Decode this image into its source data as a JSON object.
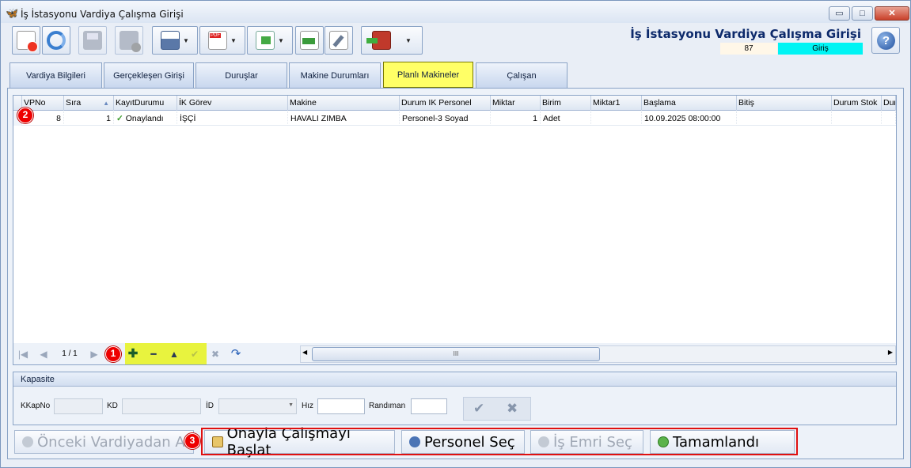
{
  "window": {
    "title": "İş İstasyonu Vardiya Çalışma Girişi",
    "controls": {
      "minimize": "▭",
      "maximize": "□",
      "close": "✕"
    }
  },
  "header": {
    "form_title": "İş İstasyonu Vardiya Çalışma Girişi",
    "record_number": "87",
    "mode": "Giriş",
    "mode_color": "#00f4f4"
  },
  "toolbar": {
    "buttons": [
      {
        "icon": "new-delete-icon"
      },
      {
        "icon": "refresh-icon"
      },
      {
        "icon": "save-icon"
      },
      {
        "icon": "save-cancel-icon"
      },
      {
        "icon": "print-icon"
      },
      {
        "icon": "pdf-export-icon"
      },
      {
        "icon": "copy-export-icon"
      },
      {
        "icon": "import-icon"
      },
      {
        "icon": "settings-wrench-icon"
      },
      {
        "icon": "exit-door-icon"
      }
    ]
  },
  "tabs": [
    {
      "label": "Vardiya Bilgileri"
    },
    {
      "label": "Gerçekleşen Girişi"
    },
    {
      "label": "Duruşlar"
    },
    {
      "label": "Makine Durumları"
    },
    {
      "label": "Planlı Makineler",
      "active": true
    },
    {
      "label": "Çalışan"
    }
  ],
  "grid": {
    "columns": [
      "VPNo",
      "Sıra",
      "KayıtDurumu",
      "İK Görev",
      "Makine",
      "Durum IK Personel",
      "Miktar",
      "Birim",
      "Miktar1",
      "Başlama",
      "Bitiş",
      "Durum Stok",
      "Dur"
    ],
    "rows": [
      {
        "VPNo": "8",
        "Sira": "1",
        "KayitDurumu": "Onaylandı",
        "IKGorev": "İŞÇİ",
        "Makine": "HAVALI ZIMBA",
        "DurumIKPersonel": "Personel-3 Soyad",
        "Miktar": "1",
        "Birim": "Adet",
        "Miktar1": "",
        "Baslama": "10.09.2025 08:00:00",
        "Bitis": "",
        "DurumStok": "",
        "Dur": ""
      }
    ],
    "sort_indicator": "▲"
  },
  "navigator": {
    "first": "|◀",
    "prev": "◀",
    "page": "1 / 1",
    "next": "▶",
    "add": "✚",
    "remove": "━",
    "up": "▲",
    "confirm": "✔",
    "cancel": "✖",
    "redo": "↷",
    "scroll_left": "◀",
    "scroll_right": "▶",
    "scroll_grip": "III"
  },
  "annotations": {
    "badge1": "1",
    "badge2": "2",
    "badge3": "3"
  },
  "kapasite": {
    "title": "Kapasite",
    "labels": {
      "kkapno": "KKapNo",
      "kd": "KD",
      "id": "İD",
      "hiz": "Hız",
      "randiman": "Randıman"
    },
    "confirm": "✔",
    "cancel": "✖"
  },
  "bottom_buttons": {
    "onceki": "Önceki Vardiyadan Al",
    "onayla": "Onayla Çalışmayı Başlat",
    "personel": "Personel Seç",
    "is_emri": "İş Emri Seç",
    "tamamlandi": "Tamamlandı"
  }
}
